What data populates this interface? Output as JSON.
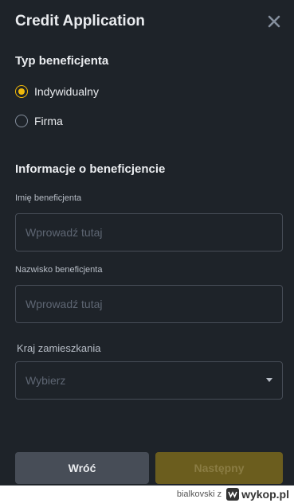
{
  "header": {
    "title": "Credit Application"
  },
  "beneficiary_type": {
    "title": "Typ beneficjenta",
    "options": [
      {
        "label": "Indywidualny",
        "checked": true
      },
      {
        "label": "Firma",
        "checked": false
      }
    ]
  },
  "beneficiary_info": {
    "title": "Informacje o beneficjencie",
    "first_name": {
      "label": "Imię beneficjenta",
      "placeholder": "Wprowadź tutaj"
    },
    "last_name": {
      "label": "Nazwisko beneficjenta",
      "placeholder": "Wprowadź tutaj"
    },
    "country": {
      "label": "Kraj zamieszkania",
      "placeholder": "Wybierz"
    }
  },
  "buttons": {
    "back": "Wróć",
    "next": "Następny"
  },
  "footer": {
    "user": "bialkovski z",
    "site": "wykop.pl"
  },
  "colors": {
    "background": "#1e2329",
    "accent": "#f0b90b",
    "next_button_disabled": "#6b5d1e",
    "back_button": "#474d57"
  }
}
